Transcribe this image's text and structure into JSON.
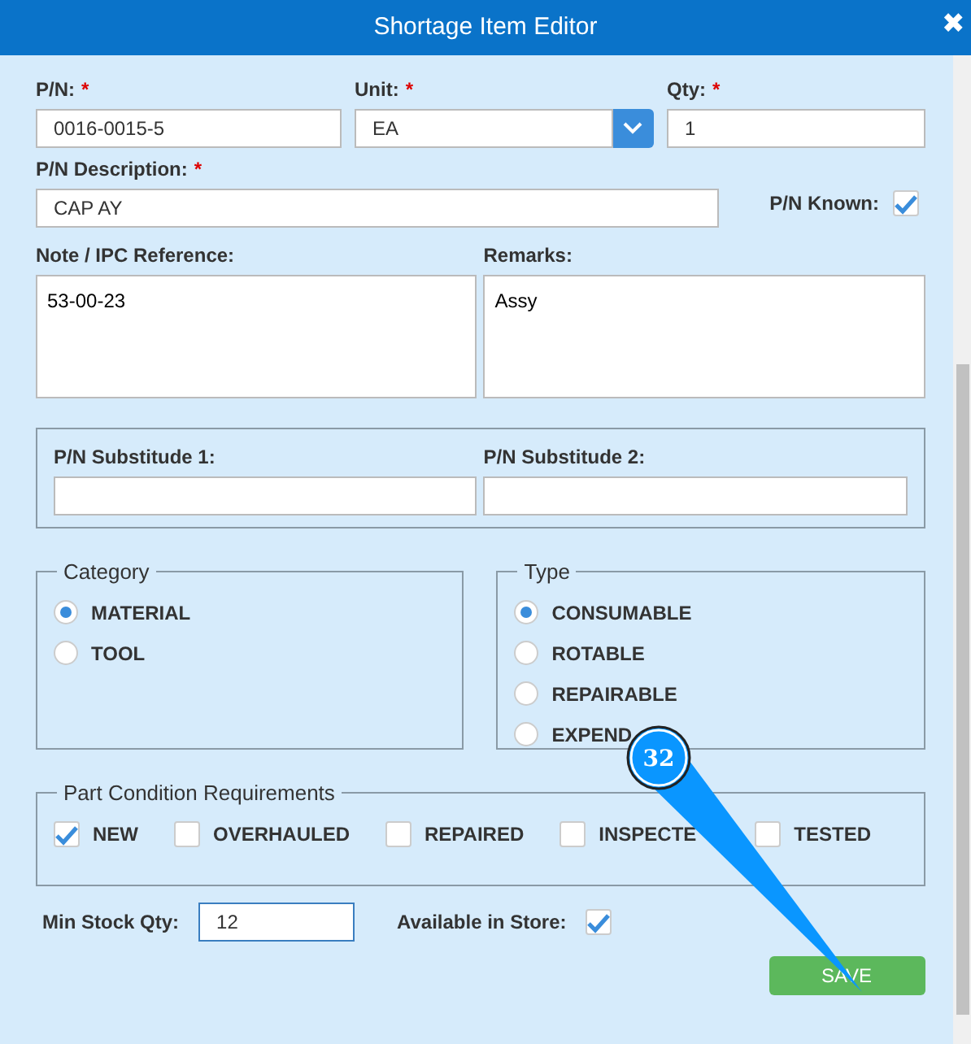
{
  "window": {
    "title": "Shortage Item Editor",
    "close": "✖"
  },
  "part": {
    "pn": {
      "label": "P/N:",
      "required_mark": "*",
      "value": "0016-0015-5"
    },
    "unit": {
      "label": "Unit:",
      "required_mark": "*",
      "value": "EA"
    },
    "qty": {
      "label": "Qty:",
      "required_mark": "*",
      "value": "1"
    },
    "description": {
      "label": "P/N Description:",
      "required_mark": "*",
      "value": "CAP AY"
    },
    "pn_known": {
      "label": "P/N Known:",
      "checked": true
    }
  },
  "note": {
    "label": "Note / IPC Reference:",
    "value": "53-00-23"
  },
  "remarks": {
    "label": "Remarks:",
    "value": "Assy"
  },
  "substitutes": [
    {
      "label": "P/N Substitude 1:"
    },
    {
      "label": "P/N Substitude 2:"
    }
  ],
  "category": {
    "legend": "Category",
    "options": [
      {
        "label": "MATERIAL",
        "selected": true
      },
      {
        "label": "TOOL",
        "selected": false
      }
    ]
  },
  "type": {
    "legend": "Type",
    "options": [
      {
        "label": "CONSUMABLE",
        "selected": true
      },
      {
        "label": "ROTABLE",
        "selected": false
      },
      {
        "label": "REPAIRABLE",
        "selected": false
      },
      {
        "label": "EXPEND",
        "selected": false
      }
    ]
  },
  "conditions": {
    "legend": "Part Condition Requirements",
    "options": [
      {
        "label": "NEW",
        "checked": true
      },
      {
        "label": "OVERHAULED",
        "checked": false
      },
      {
        "label": "REPAIRED",
        "checked": false
      },
      {
        "label": "INSPECTE",
        "checked": false
      },
      {
        "label": "TESTED",
        "checked": false
      }
    ]
  },
  "min_stock": {
    "label": "Min Stock Qty:",
    "value": "12"
  },
  "available": {
    "label": "Available in Store:",
    "checked": true
  },
  "save_button": "SAVE",
  "callout": {
    "number": "32"
  }
}
